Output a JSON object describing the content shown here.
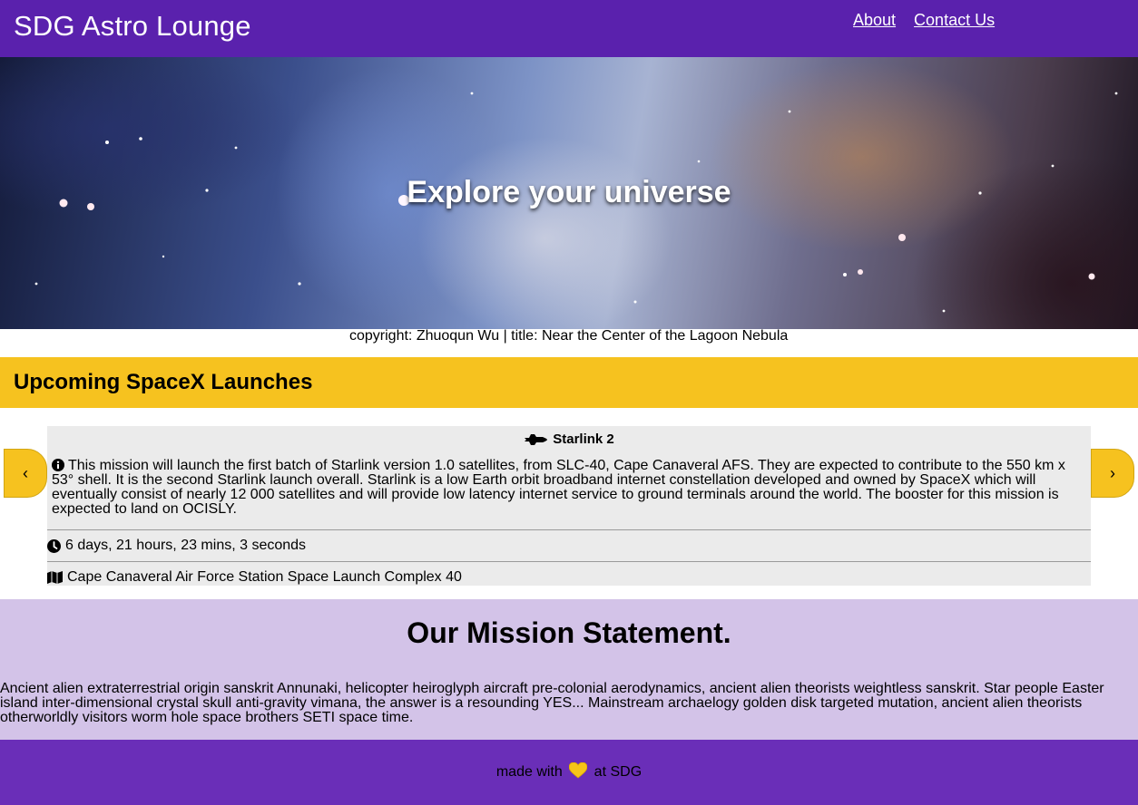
{
  "header": {
    "brand": "SDG Astro Lounge",
    "nav": [
      "About",
      "Contact Us"
    ]
  },
  "hero": {
    "title": "Explore your universe",
    "credit": "copyright: Zhuoqun Wu | title: Near the Center of the Lagoon Nebula"
  },
  "launches": {
    "heading": "Upcoming SpaceX Launches",
    "prev_label": "‹",
    "next_label": "›",
    "card": {
      "name": "Starlink 2",
      "description": "This mission will launch the first batch of Starlink version 1.0 satellites, from SLC-40, Cape Canaveral AFS. They are expected to contribute to the 550 km x 53° shell. It is the second Starlink launch overall. Starlink is a low Earth orbit broadband internet constellation developed and owned by SpaceX which will eventually consist of nearly 12 000 satellites and will provide low latency internet service to ground terminals around the world. The booster for this mission is expected to land on OCISLY.",
      "countdown": "6 days, 21 hours, 23 mins, 3 seconds",
      "site": "Cape Canaveral Air Force Station Space Launch Complex 40",
      "icons": {
        "title": "space-shuttle-icon",
        "info": "info-circle-icon",
        "clock": "clock-icon",
        "map": "map-icon"
      }
    }
  },
  "mission": {
    "heading": "Our Mission Statement.",
    "body": "Ancient alien extraterrestrial origin sanskrit Annunaki, helicopter heiroglyph aircraft pre-colonial aerodynamics, ancient alien theorists weightless sanskrit. Star people Easter island inter-dimensional crystal skull anti-gravity vimana, the answer is a resounding YES... Mainstream archaelogy golden disk targeted mutation, ancient alien theorists otherworldly visitors worm hole space brothers SETI space time."
  },
  "footer": {
    "prefix": "made with",
    "suffix": "at SDG",
    "icon": "yellow-heart-icon"
  },
  "colors": {
    "header": "#5a21ad",
    "accent": "#f6c21f",
    "mission_bg": "#d3c3e8",
    "footer": "#6a2eb8",
    "card_bg": "#ebebeb"
  }
}
